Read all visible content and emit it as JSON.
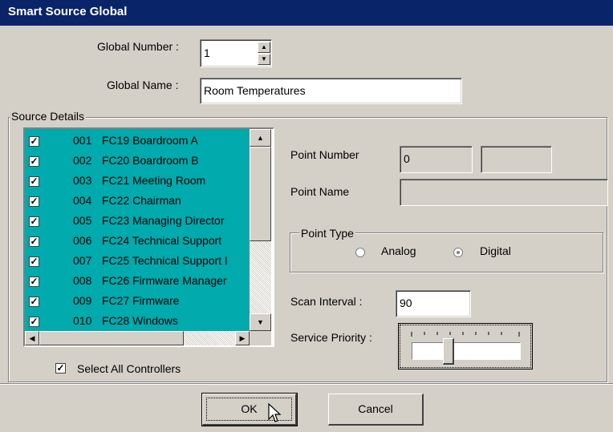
{
  "title": "Smart Source Global",
  "global_number": {
    "label": "Global Number :",
    "value": "1"
  },
  "global_name": {
    "label": "Global Name :",
    "value": "Room Temperatures"
  },
  "source_details": {
    "title": "Source Details",
    "rows": [
      {
        "num": "001",
        "name": "FC19 Boardroom A",
        "checked": true
      },
      {
        "num": "002",
        "name": "FC20 Boardroom B",
        "checked": true
      },
      {
        "num": "003",
        "name": "FC21 Meeting Room",
        "checked": true
      },
      {
        "num": "004",
        "name": "FC22 Chairman",
        "checked": true
      },
      {
        "num": "005",
        "name": "FC23 Managing Director",
        "checked": true
      },
      {
        "num": "006",
        "name": "FC24 Technical Support",
        "checked": true
      },
      {
        "num": "007",
        "name": "FC25 Technical Support I",
        "checked": true
      },
      {
        "num": "008",
        "name": "FC26 Firmware Manager",
        "checked": true
      },
      {
        "num": "009",
        "name": "FC27 Firmware",
        "checked": true
      },
      {
        "num": "010",
        "name": "FC28 Windows",
        "checked": true
      }
    ],
    "select_all_label": "Select All Controllers",
    "select_all_checked": true
  },
  "point_number": {
    "label": "Point Number",
    "value": "0",
    "value2": ""
  },
  "point_name": {
    "label": "Point Name",
    "value": ""
  },
  "point_type": {
    "title": "Point Type",
    "options": [
      "Analog",
      "Digital"
    ],
    "selected": "Digital"
  },
  "scan_interval": {
    "label": "Scan Interval :",
    "value": "90"
  },
  "service_priority": {
    "label": "Service Priority :",
    "level": 0.32
  },
  "buttons": {
    "ok": "OK",
    "cancel": "Cancel"
  }
}
